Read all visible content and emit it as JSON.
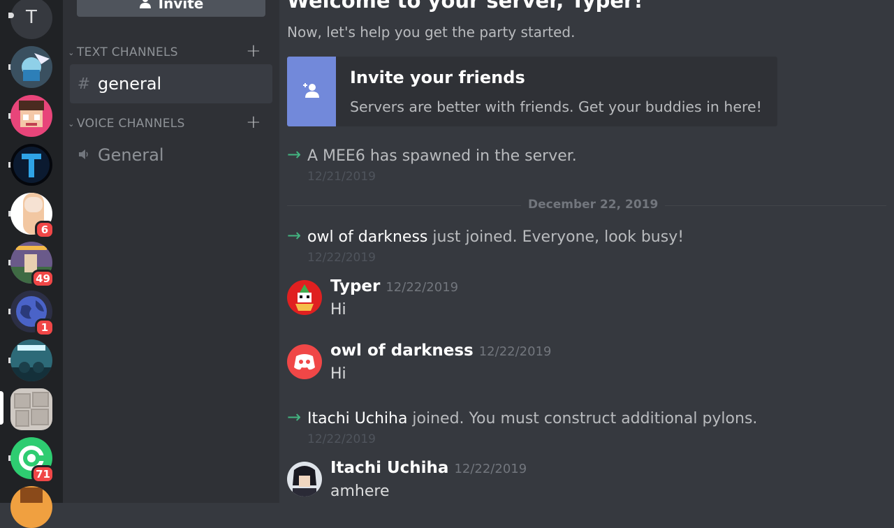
{
  "server": {
    "letter": "T",
    "badges": [
      "6",
      "49",
      "1",
      "71"
    ]
  },
  "channels": {
    "invite_label": "Invite",
    "text_category": "TEXT CHANNELS",
    "voice_category": "VOICE CHANNELS",
    "text_channel": "general",
    "voice_channel": "General"
  },
  "welcome": {
    "title": "Welcome to your server, Typer!",
    "subtitle": "Now, let's help you get the party started.",
    "card_title": "Invite your friends",
    "card_desc": "Servers are better with friends. Get your buddies in here!"
  },
  "divider_date": "December 22, 2019",
  "messages": [
    {
      "type": "system",
      "user": "",
      "text": "A MEE6 has spawned in the server.",
      "ts": "12/21/2019"
    },
    {
      "type": "system",
      "user": "owl of darkness",
      "text": " just joined. Everyone, look busy!",
      "ts": "12/22/2019"
    },
    {
      "type": "chat",
      "author": "Typer",
      "ts": "12/22/2019",
      "body": "Hi"
    },
    {
      "type": "chat",
      "author": "owl of darkness",
      "ts": "12/22/2019",
      "body": "Hi"
    },
    {
      "type": "system",
      "user": "Itachi Uchiha",
      "text": " joined. You must construct additional pylons.",
      "ts": "12/22/2019"
    },
    {
      "type": "chat",
      "author": "Itachi Uchiha",
      "ts": "12/22/2019",
      "body": "amhere"
    }
  ],
  "colors": {
    "accent": "#7289da",
    "online": "#43b581",
    "badge": "#f04747",
    "discord_red": "#f04747"
  }
}
